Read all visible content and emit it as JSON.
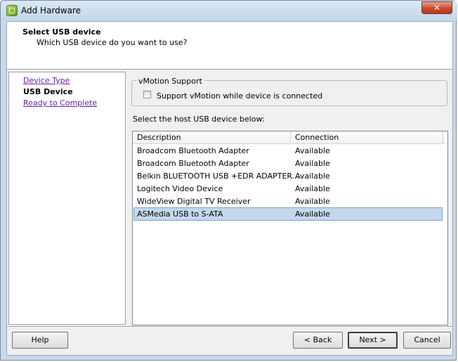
{
  "window": {
    "title": "Add Hardware",
    "close_label": "✕",
    "icon": "vsphere-icon"
  },
  "header": {
    "title": "Select USB device",
    "subtitle": "Which USB device do you want to use?"
  },
  "steps": [
    {
      "label": "Device Type",
      "state": "link"
    },
    {
      "label": "USB Device",
      "state": "current"
    },
    {
      "label": "Ready to Complete",
      "state": "link"
    }
  ],
  "vmotion": {
    "group_label": "vMotion Support",
    "checkbox_label": "Support vMotion while device is connected",
    "checked": false
  },
  "list": {
    "prompt": "Select the host USB device below:",
    "columns": [
      "Description",
      "Connection"
    ],
    "rows": [
      {
        "description": "Broadcom Bluetooth Adapter",
        "connection": "Available"
      },
      {
        "description": "Broadcom Bluetooth Adapter",
        "connection": "Available"
      },
      {
        "description": "Belkin BLUETOOTH USB +EDR ADAPTER...",
        "connection": "Available"
      },
      {
        "description": "Logitech Video Device",
        "connection": "Available"
      },
      {
        "description": "WideView Digital TV Receiver",
        "connection": "Available"
      },
      {
        "description": "ASMedia USB to S-ATA",
        "connection": "Available",
        "selected": true
      }
    ]
  },
  "buttons": {
    "help": "Help",
    "back": "< Back",
    "next": "Next >",
    "cancel": "Cancel"
  },
  "colors": {
    "selection": "#c4d7ec",
    "link": "#6a1ea8",
    "close": "#c9492d"
  }
}
